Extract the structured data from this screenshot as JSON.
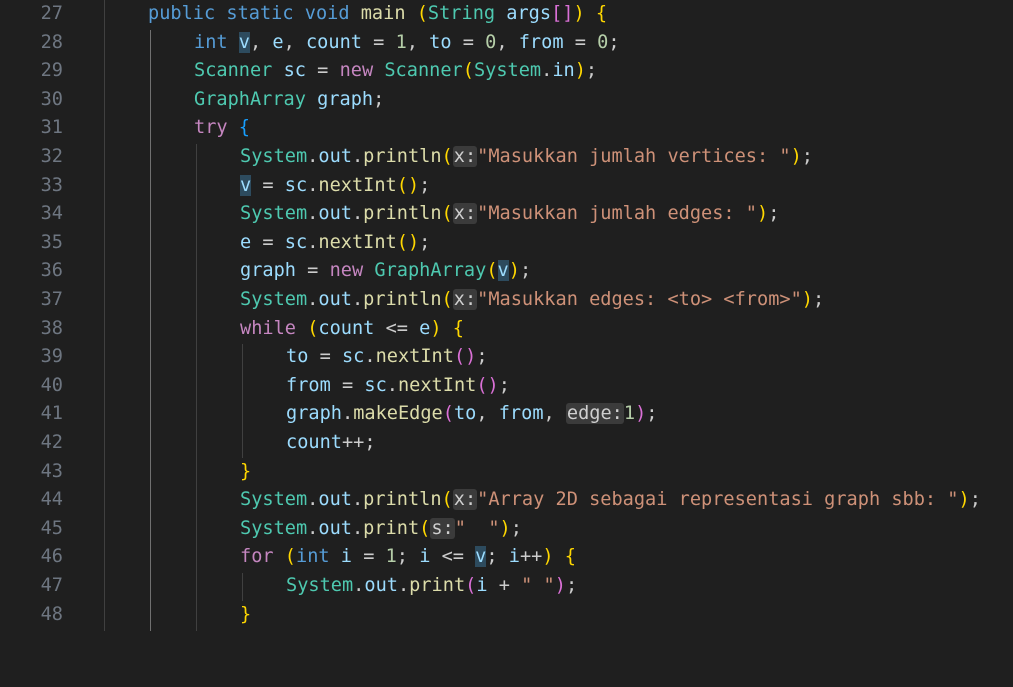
{
  "editor": {
    "line_numbers": [
      "27",
      "28",
      "29",
      "30",
      "31",
      "32",
      "33",
      "34",
      "35",
      "36",
      "37",
      "38",
      "39",
      "40",
      "41",
      "42",
      "43",
      "44",
      "45",
      "46",
      "47",
      "48"
    ]
  },
  "code": {
    "l27": {
      "a": "public",
      "b": "static",
      "c": "void",
      "d": "main",
      "e": "(",
      "f": "String",
      "g": "args",
      "h": "[]",
      ")": ")",
      "i": "{"
    },
    "l28": {
      "a": "int",
      "b": "v",
      "c": ", ",
      "d": "e",
      "e": ", ",
      "f": "count",
      "g": " = ",
      "h": "1",
      "i": ", ",
      "j": "to",
      "k": " = ",
      "l": "0",
      "m": ", ",
      "n": "from",
      "o": " = ",
      "p": "0",
      "q": ";"
    },
    "l29": {
      "a": "Scanner",
      "b": "sc",
      "c": " = ",
      "d": "new",
      "e": "Scanner",
      "f": "(",
      "g": "System",
      "h": ".",
      "i": "in",
      "j": ")",
      "k": ";"
    },
    "l30": {
      "a": "GraphArray",
      "b": "graph",
      "c": ";"
    },
    "l31": {
      "a": "try",
      "b": "{"
    },
    "l32": {
      "a": "System",
      "b": ".",
      "c": "out",
      "d": ".",
      "e": "println",
      "f": "(",
      "g": "x:",
      "h": "\"Masukkan jumlah vertices: \"",
      "i": ")",
      "j": ";"
    },
    "l33": {
      "a": "v",
      "b": " = ",
      "c": "sc",
      "d": ".",
      "e": "nextInt",
      "f": "()",
      "g": ";"
    },
    "l34": {
      "a": "System",
      "b": ".",
      "c": "out",
      "d": ".",
      "e": "println",
      "f": "(",
      "g": "x:",
      "h": "\"Masukkan jumlah edges: \"",
      "i": ")",
      "j": ";"
    },
    "l35": {
      "a": "e",
      "b": " = ",
      "c": "sc",
      "d": ".",
      "e": "nextInt",
      "f": "()",
      "g": ";"
    },
    "l36": {
      "a": "graph",
      "b": " = ",
      "c": "new",
      "d": "GraphArray",
      "e": "(",
      "f": "v",
      "g": ")",
      "h": ";"
    },
    "l37": {
      "a": "System",
      "b": ".",
      "c": "out",
      "d": ".",
      "e": "println",
      "f": "(",
      "g": "x:",
      "h": "\"Masukkan edges: <to> <from>\"",
      "i": ")",
      "j": ";"
    },
    "l38": {
      "a": "while",
      "b": "(",
      "c": "count",
      "d": " <= ",
      "e": "e",
      "f": ")",
      "g": "{"
    },
    "l39": {
      "a": "to",
      "b": " = ",
      "c": "sc",
      "d": ".",
      "e": "nextInt",
      "f": "()",
      "g": ";"
    },
    "l40": {
      "a": "from",
      "b": " = ",
      "c": "sc",
      "d": ".",
      "e": "nextInt",
      "f": "()",
      "g": ";"
    },
    "l41": {
      "a": "graph",
      "b": ".",
      "c": "makeEdge",
      "d": "(",
      "e": "to",
      "f": ", ",
      "g": "from",
      "h": ", ",
      "i": "edge:",
      "j": "1",
      "k": ")",
      "l": ";"
    },
    "l42": {
      "a": "count",
      "b": "++;"
    },
    "l43": {
      "a": "}"
    },
    "l44": {
      "a": "System",
      "b": ".",
      "c": "out",
      "d": ".",
      "e": "println",
      "f": "(",
      "g": "x:",
      "h": "\"Array 2D sebagai representasi graph sbb: \"",
      "i": ")",
      "j": ";"
    },
    "l45": {
      "a": "System",
      "b": ".",
      "c": "out",
      "d": ".",
      "e": "print",
      "f": "(",
      "g": "s:",
      "h": "\"  \"",
      "i": ")",
      "j": ";"
    },
    "l46": {
      "a": "for",
      "b": "(",
      "c": "int",
      "d": "i",
      "e": " = ",
      "f": "1",
      "g": "; ",
      "h": "i",
      "i": " <= ",
      "j": "v",
      "k": "; ",
      "l": "i",
      "m": "++",
      "n": ")",
      "o": "{"
    },
    "l47": {
      "a": "System",
      "b": ".",
      "c": "out",
      "d": ".",
      "e": "print",
      "f": "(",
      "g": "i",
      "h": " + ",
      "i": "\" \"",
      "j": ")",
      "k": ";"
    },
    "l48": {
      "a": "}"
    }
  }
}
